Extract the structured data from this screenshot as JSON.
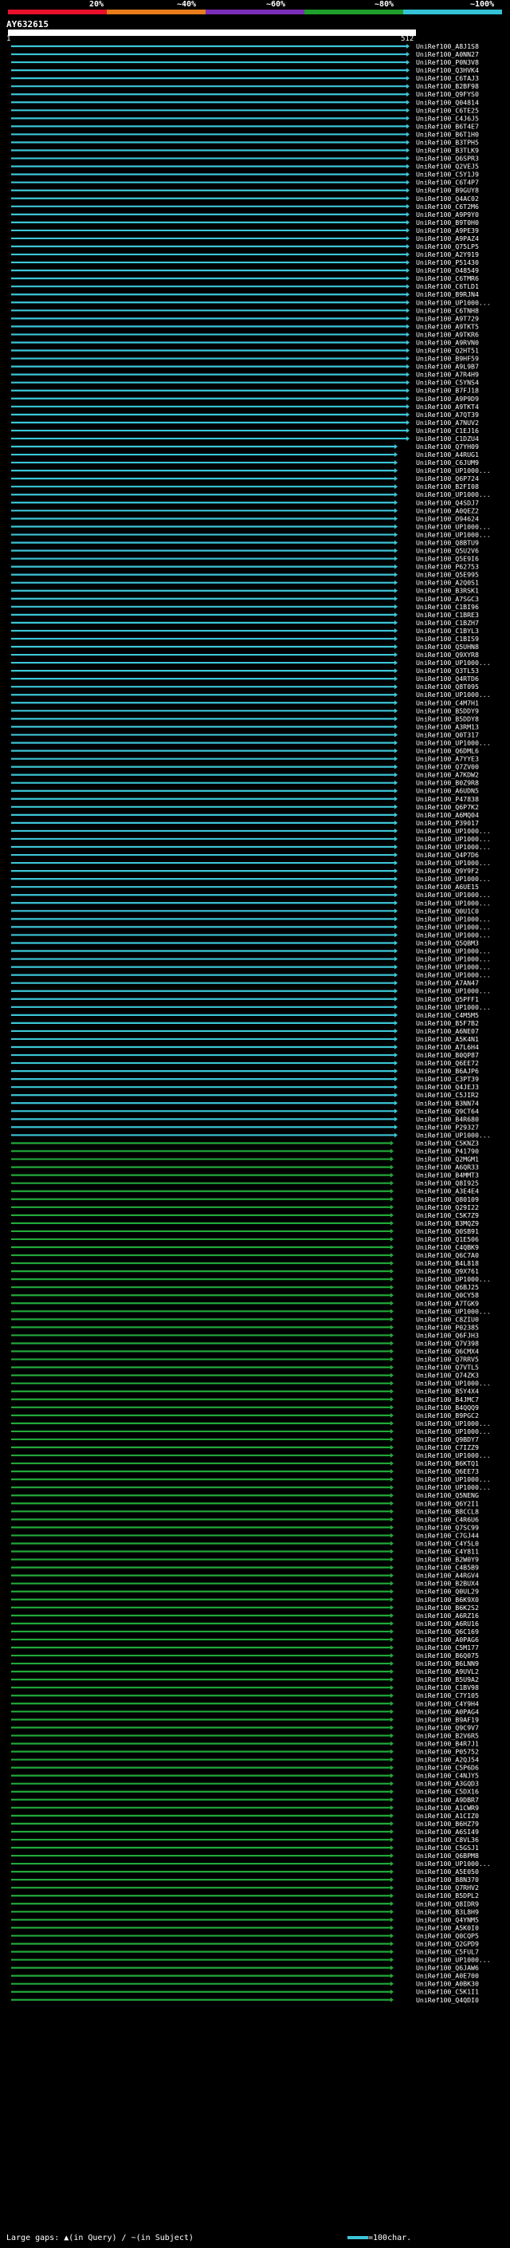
{
  "scale": {
    "ticks": [
      "20%",
      "~40%",
      "~60%",
      "~80%",
      "~100%"
    ],
    "colors": [
      "#e8102b",
      "#e87c1a",
      "#7b2fb8",
      "#1e9e2a",
      "#34c3d6"
    ]
  },
  "query": {
    "name": "AY632615",
    "start": "1",
    "end": "512"
  },
  "hit_color_high": "#3cc6d8",
  "hit_color_mid": "#22a83a",
  "hits": [
    "UniRef100_A8J1S8",
    "UniRef100_A0NN27",
    "UniRef100_P0N3V8",
    "UniRef100_Q3HVK4",
    "UniRef100_C6TAJ3",
    "UniRef100_B2BF98",
    "UniRef100_Q9FYS0",
    "UniRef100_Q04814",
    "UniRef100_C6TE25",
    "UniRef100_C4J6J5",
    "UniRef100_B6T4E7",
    "UniRef100_B6T1H0",
    "UniRef100_B3TPH5",
    "UniRef100_B3TLK9",
    "UniRef100_Q6SPR3",
    "UniRef100_Q2VEJ5",
    "UniRef100_C5Y1J9",
    "UniRef100_C6T4P7",
    "UniRef100_B9GUY8",
    "UniRef100_Q4AC02",
    "UniRef100_C6T2M6",
    "UniRef100_A9P9Y0",
    "UniRef100_B9T0H0",
    "UniRef100_A9PE39",
    "UniRef100_A9PAZ4",
    "UniRef100_Q75LP5",
    "UniRef100_A2Y919",
    "UniRef100_P51430",
    "UniRef100_O48549",
    "UniRef100_C6TMR6",
    "UniRef100_C6TLD1",
    "UniRef100_B9RJN4",
    "UniRef100_UP1000...",
    "UniRef100_C6TNH8",
    "UniRef100_A9T729",
    "UniRef100_A9TKT5",
    "UniRef100_A9TKR6",
    "UniRef100_A9RVN0",
    "UniRef100_Q2HT51",
    "UniRef100_B9HF59",
    "UniRef100_A9L9B7",
    "UniRef100_A7R4H9",
    "UniRef100_C5YNS4",
    "UniRef100_B7FJ18",
    "UniRef100_A9P9D9",
    "UniRef100_A9TKT4",
    "UniRef100_A7QT39",
    "UniRef100_A7NUV2",
    "UniRef100_C1EJ16",
    "UniRef100_C1DZU4",
    "UniRef100_Q7YH09",
    "UniRef100_A4RUG1",
    "UniRef100_C6JUM9",
    "UniRef100_UP1000...",
    "UniRef100_Q6P724",
    "UniRef100_B2FI08",
    "UniRef100_UP1000...",
    "UniRef100_Q4SDJ7",
    "UniRef100_A0QEZ2",
    "UniRef100_O94624",
    "UniRef100_UP1000...",
    "UniRef100_UP1000...",
    "UniRef100_Q8BTU9",
    "UniRef100_Q5U2V6",
    "UniRef100_Q5E9I6",
    "UniRef100_P62753",
    "UniRef100_Q5E995",
    "UniRef100_A2Q0S1",
    "UniRef100_B3RSK1",
    "UniRef100_A7SGC3",
    "UniRef100_C1BI96",
    "UniRef100_C1BRE3",
    "UniRef100_C1BZH7",
    "UniRef100_C1BYL3",
    "UniRef100_C1BIS9",
    "UniRef100_Q5UHN8",
    "UniRef100_Q9XYR8",
    "UniRef100_UP1000...",
    "UniRef100_Q3TL53",
    "UniRef100_Q4RTD6",
    "UniRef100_Q8T095",
    "UniRef100_UP1000...",
    "UniRef100_C4M7H1",
    "UniRef100_B5DDY9",
    "UniRef100_B5DDY8",
    "UniRef100_A3RM13",
    "UniRef100_Q0T317",
    "UniRef100_UP1000...",
    "UniRef100_Q6DML6",
    "UniRef100_A7YYE3",
    "UniRef100_Q7ZV00",
    "UniRef100_A7KDW2",
    "UniRef100_B0Z9R8",
    "UniRef100_A6UDN5",
    "UniRef100_P47838",
    "UniRef100_Q6P7K2",
    "UniRef100_A6MQ04",
    "UniRef100_P39017",
    "UniRef100_UP1000...",
    "UniRef100_UP1000...",
    "UniRef100_UP1000...",
    "UniRef100_Q4P7D6",
    "UniRef100_UP1000...",
    "UniRef100_Q9Y9F2",
    "UniRef100_UP1000...",
    "UniRef100_A6UE15",
    "UniRef100_UP1000...",
    "UniRef100_UP1000...",
    "UniRef100_Q0U1C0",
    "UniRef100_UP1000...",
    "UniRef100_UP1000...",
    "UniRef100_UP1000...",
    "UniRef100_Q5QBM3",
    "UniRef100_UP1000...",
    "UniRef100_UP1000...",
    "UniRef100_UP1000...",
    "UniRef100_UP1000...",
    "UniRef100_A7AN47",
    "UniRef100_UP1000...",
    "UniRef100_Q5PFF1",
    "UniRef100_UP1000...",
    "UniRef100_C4M5M5",
    "UniRef100_B5F7B2",
    "UniRef100_A6NE07",
    "UniRef100_A5K4N1",
    "UniRef100_A7L6H4",
    "UniRef100_B0QP87",
    "UniRef100_Q6EE72",
    "UniRef100_B6AJP6",
    "UniRef100_C3PT39",
    "UniRef100_Q4JEJ3",
    "UniRef100_C5JIR2",
    "UniRef100_B3NN74",
    "UniRef100_Q9CT64",
    "UniRef100_B4R680",
    "UniRef100_P29327",
    "UniRef100_UP1000...",
    "UniRef100_C5KNZ3",
    "UniRef100_P41790",
    "UniRef100_Q2MGM1",
    "UniRef100_A6QR33",
    "UniRef100_B4MMT3",
    "UniRef100_Q8I925",
    "UniRef100_A3E4E4",
    "UniRef100_Q80109",
    "UniRef100_Q29I22",
    "UniRef100_C5K7Z9",
    "UniRef100_B3MQZ9",
    "UniRef100_Q0SB91",
    "UniRef100_Q1E506",
    "UniRef100_C4QBK9",
    "UniRef100_Q6C7A0",
    "UniRef100_B4L818",
    "UniRef100_Q9X761",
    "UniRef100_UP1000...",
    "UniRef100_Q6BJ25",
    "UniRef100_Q0CY58",
    "UniRef100_A7TGK9",
    "UniRef100_UP1000...",
    "UniRef100_C8ZIU0",
    "UniRef100_P02385",
    "UniRef100_Q6FJH3",
    "UniRef100_Q7V398",
    "UniRef100_Q6CMX4",
    "UniRef100_Q7RRV5",
    "UniRef100_Q7VTL5",
    "UniRef100_Q74ZK3",
    "UniRef100_UP1000...",
    "UniRef100_B5Y4X4",
    "UniRef100_B4JMC7",
    "UniRef100_B4QQQ9",
    "UniRef100_B9PGC2",
    "UniRef100_UP1000...",
    "UniRef100_UP1000...",
    "UniRef100_Q9BDY7",
    "UniRef100_C7IZZ9",
    "UniRef100_UP1000...",
    "UniRef100_B6KTQ1",
    "UniRef100_Q6EE73",
    "UniRef100_UP1000...",
    "UniRef100_UP1000...",
    "UniRef100_Q5NENG",
    "UniRef100_Q6Y2I1",
    "UniRef100_B8CCL8",
    "UniRef100_C4R6U6",
    "UniRef100_Q7SC99",
    "UniRef100_C7GJ44",
    "UniRef100_C4Y5L0",
    "UniRef100_C4Y811",
    "UniRef100_B2W0Y9",
    "UniRef100_C4B5B9",
    "UniRef100_A4RGV4",
    "UniRef100_B2BUX4",
    "UniRef100_Q0UL29",
    "UniRef100_B6K9X0",
    "UniRef100_B6K2S2",
    "UniRef100_A6RZ16",
    "UniRef100_A6RU16",
    "UniRef100_Q6C169",
    "UniRef100_A0PAG6",
    "UniRef100_C5M177",
    "UniRef100_B6Q075",
    "UniRef100_B6LNN9",
    "UniRef100_A9UVL2",
    "UniRef100_B5U9A2",
    "UniRef100_C1BV98",
    "UniRef100_C7Y105",
    "UniRef100_C4Y9H4",
    "UniRef100_A0PAG4",
    "UniRef100_B9AF19",
    "UniRef100_Q9C9V7",
    "UniRef100_B2V6R5",
    "UniRef100_B4R7J1",
    "UniRef100_P05752",
    "UniRef100_A2QJ54",
    "UniRef100_C5P6D6",
    "UniRef100_C4NJY5",
    "UniRef100_A3GQD3",
    "UniRef100_C5DX16",
    "UniRef100_A9DBR7",
    "UniRef100_A1CWR9",
    "UniRef100_A1CIZ0",
    "UniRef100_B6HZ79",
    "UniRef100_A6SI49",
    "UniRef100_C8VL36",
    "UniRef100_C5GSJ1",
    "UniRef100_Q6BPM8",
    "UniRef100_UP1000...",
    "UniRef100_A5E050",
    "UniRef100_B8N370",
    "UniRef100_Q7RHV2",
    "UniRef100_B5DPL2",
    "UniRef100_Q8IDR9",
    "UniRef100_B3L8H9",
    "UniRef100_Q4YNM5",
    "UniRef100_A5K0I0",
    "UniRef100_Q0CQP5",
    "UniRef100_Q2GPD9",
    "UniRef100_C5FUL7",
    "UniRef100_UP1000...",
    "UniRef100_Q6JAW6",
    "UniRef100_A0E700",
    "UniRef100_A0BK30",
    "UniRef100_C5K1I1",
    "UniRef100_Q4QDI0"
  ],
  "legend": {
    "gaps_label": "Large gaps:",
    "in_query": "(in Query)",
    "separator": "/",
    "in_subject": "(in Subject)",
    "scale_label": "=100char."
  }
}
